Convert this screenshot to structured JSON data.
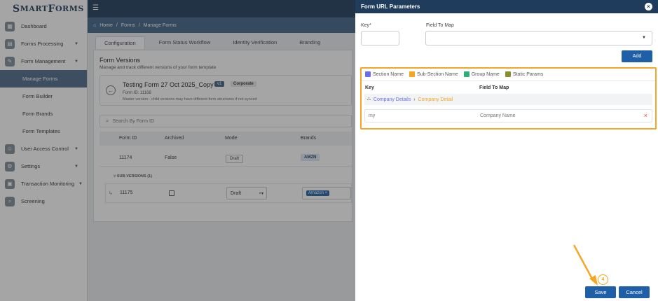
{
  "app": {
    "logo_first": "S",
    "logo_rest": "MART ",
    "logo_first2": "F",
    "logo_rest2": "ORMS"
  },
  "sidebar": {
    "items": [
      {
        "label": "Dashboard",
        "icon": "dashboard-icon"
      },
      {
        "label": "Forms Processing",
        "icon": "forms-processing-icon"
      },
      {
        "label": "Form Management",
        "icon": "form-management-icon"
      },
      {
        "label": "Manage Forms",
        "sub": true,
        "active": true
      },
      {
        "label": "Form Builder",
        "sub": true
      },
      {
        "label": "Form Brands",
        "sub": true
      },
      {
        "label": "Form Templates",
        "sub": true
      },
      {
        "label": "User Access Control",
        "icon": "user-access-icon"
      },
      {
        "label": "Settings",
        "icon": "settings-icon"
      },
      {
        "label": "Transaction Monitoring",
        "icon": "transaction-icon"
      },
      {
        "label": "Screening",
        "icon": "screening-icon"
      }
    ]
  },
  "breadcrumb": {
    "home": "Home",
    "sep": "/",
    "forms": "Forms",
    "current": "Manage Forms"
  },
  "tabs": [
    {
      "label": "Configuration",
      "active": true
    },
    {
      "label": "Form Status Workflow"
    },
    {
      "label": "Identity Verification"
    },
    {
      "label": "Branding"
    }
  ],
  "form_versions": {
    "title": "Form Versions",
    "subtitle": "Manage and track different versions of your form template",
    "form_name": "Testing Form 27 Oct 2025_Copy",
    "version_badge": "v1",
    "type_badge": "Corporate",
    "form_id": "Form ID: 11168",
    "master_note": "Master version - child versions may have different form structures if not synced",
    "search_placeholder": "Search By Form ID",
    "columns": [
      "Form ID",
      "Archived",
      "Mode",
      "Brands"
    ],
    "row": {
      "id": "11174",
      "archived": "False",
      "mode": "Draft",
      "brand": "AMZN"
    },
    "sub_versions_label": "SUB-VERSIONS (1)",
    "sub_row": {
      "id": "11175",
      "mode": "Draft",
      "brand": "Amazon"
    }
  },
  "panel": {
    "title": "Form URL Parameters",
    "key_label": "Key*",
    "field_label": "Field To Map",
    "key_value": "",
    "field_value": "",
    "add_label": "Add",
    "legend": [
      {
        "label": "Section Name",
        "color": "#6a6ee8"
      },
      {
        "label": "Sub-Section Name",
        "color": "#f5a623"
      },
      {
        "label": "Group Name",
        "color": "#2fae7a"
      },
      {
        "label": "Static Params",
        "color": "#8a8f2a"
      }
    ],
    "col_key": "Key",
    "col_field": "Field To Map",
    "group_section": "Company Details",
    "group_subsection": "Company Detail",
    "mapping_key": "my",
    "mapping_field": "Company Name",
    "remove_symbol": "×",
    "save_label": "Save",
    "cancel_label": "Cancel",
    "step_number": "4"
  },
  "colors": {
    "primary": "#1f5fa8",
    "header": "#1f3c5c",
    "highlight": "#f5a623"
  }
}
